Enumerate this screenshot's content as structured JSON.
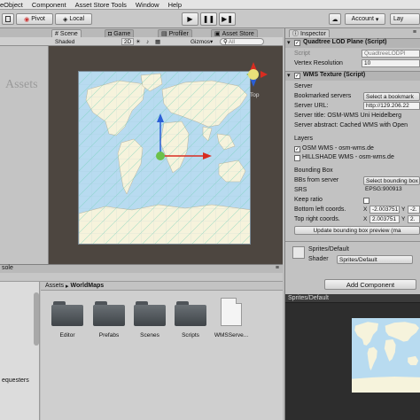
{
  "menu": [
    "eObject",
    "Component",
    "Asset Store Tools",
    "Window",
    "Help"
  ],
  "toolbar": {
    "pivot_label": "Pivot",
    "local_label": "Local",
    "account_label": "Account",
    "layers_label": "Lay"
  },
  "scene": {
    "tabs": [
      "Scene",
      "Game",
      "Profiler",
      "Asset Store"
    ],
    "shading": "Shaded",
    "mode_2d": "2D",
    "gizmos": "Gizmos",
    "search_placeholder": "All",
    "gizmo_label": "Top",
    "watermark": "Assets"
  },
  "inspector": {
    "tab": "Inspector",
    "quadtree": {
      "title": "Quadtree LOD Plane (Script)",
      "script_label": "Script",
      "script_value": "QuadtreeLODPl",
      "vertex_label": "Vertex Resolution",
      "vertex_value": "10"
    },
    "wms": {
      "title": "WMS Texture (Script)",
      "server_header": "Server",
      "bookmarked_label": "Bookmarked servers",
      "bookmarked_value": "Select a bookmark",
      "url_label": "Server URL:",
      "url_value": "http://129.206.22",
      "title_line": "Server title: OSM-WMS Uni Heidelberg",
      "abstract_line": "Server abstract: Cached WMS with Open",
      "layers_header": "Layers",
      "layer1": "OSM WMS - osm-wms.de",
      "layer2": "HILLSHADE WMS - osm-wms.de",
      "bbox_header": "Bounding Box",
      "bbs_label": "BBs from server",
      "bbs_value": "Select bounding box",
      "srs_label": "SRS",
      "srs_value": "EPSG:900913",
      "keep_ratio_label": "Keep ratio",
      "bl_label": "Bottom left coords.",
      "bl_x": "-2.003751",
      "bl_y": "-2.",
      "tr_label": "Top right coords.",
      "tr_x": "2.003751",
      "tr_y": "2.",
      "update_label": "Update bounding box preview (ma"
    },
    "material": {
      "name": "Sprites/Default",
      "shader_label": "Shader",
      "shader_value": "Sprites/Default"
    },
    "add_component": "Add Component"
  },
  "preview": {
    "title": "Sprites/Default"
  },
  "project": {
    "tab": "sole",
    "crumb1": "Assets",
    "crumb2": "WorldMaps",
    "left_item": "equesters",
    "folders": [
      "Editor",
      "Prefabs",
      "Scenes",
      "Scripts"
    ],
    "file": "WMSServe..."
  }
}
